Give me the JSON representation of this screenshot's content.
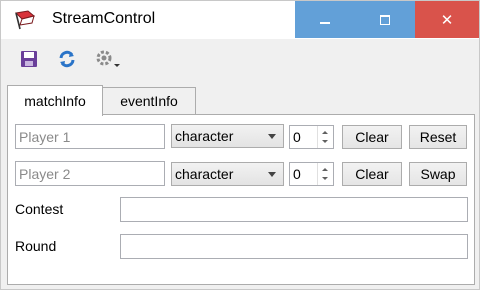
{
  "window": {
    "title": "StreamControl",
    "close_glyph": "✕"
  },
  "toolbar": {
    "save_icon": "save-icon",
    "refresh_icon": "refresh-icon",
    "settings_icon": "gear-icon"
  },
  "tabs": [
    {
      "label": "matchInfo",
      "active": true
    },
    {
      "label": "eventInfo",
      "active": false
    }
  ],
  "match": {
    "player1": {
      "name_value": "",
      "name_placeholder": "Player 1",
      "character": "character",
      "score": "0",
      "clear_label": "Clear",
      "action_label": "Reset"
    },
    "player2": {
      "name_value": "",
      "name_placeholder": "Player 2",
      "character": "character",
      "score": "0",
      "clear_label": "Clear",
      "action_label": "Swap"
    },
    "contest": {
      "label": "Contest",
      "value": ""
    },
    "round": {
      "label": "Round",
      "value": ""
    }
  },
  "colors": {
    "title_button_blue": "#62a0d8",
    "close_red": "#d9534b"
  }
}
